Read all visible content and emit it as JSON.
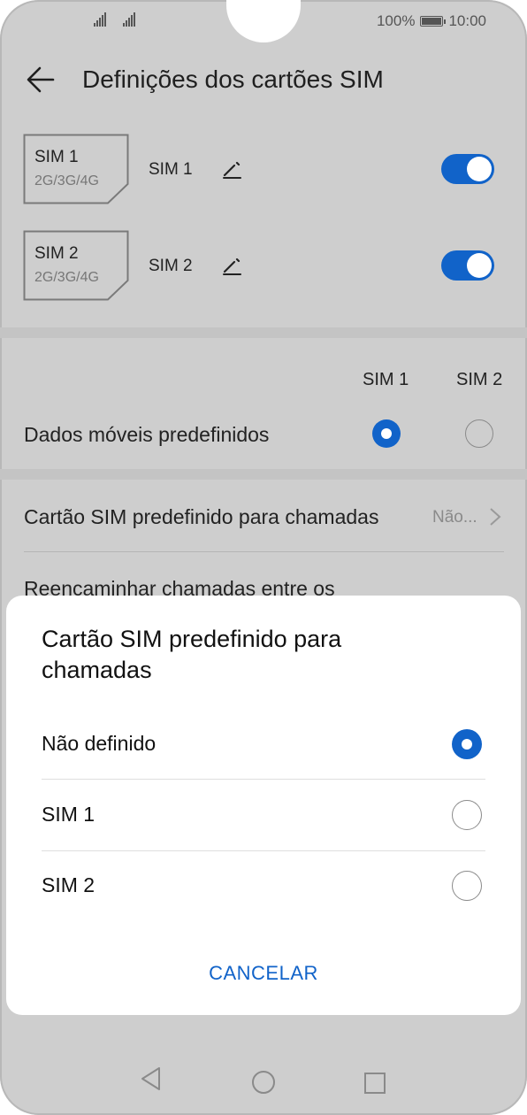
{
  "status_bar": {
    "battery": "100%",
    "time": "10:00",
    "icons": [
      "signal-1-icon",
      "signal-2-icon",
      "battery-icon"
    ]
  },
  "header": {
    "title": "Definições dos cartões SIM",
    "back_icon": "back-arrow-icon"
  },
  "sim_cards": [
    {
      "card_label": "SIM 1",
      "card_tech": "2G/3G/4G",
      "name": "SIM 1",
      "enabled": true
    },
    {
      "card_label": "SIM 2",
      "card_tech": "2G/3G/4G",
      "name": "SIM 2",
      "enabled": true
    }
  ],
  "columns": {
    "sim1": "SIM 1",
    "sim2": "SIM 2"
  },
  "mobile_data": {
    "label": "Dados móveis predefinidos",
    "selected": "SIM 1"
  },
  "default_calls": {
    "label": "Cartão SIM predefinido para chamadas",
    "value": "Não..."
  },
  "forwarding": {
    "label": "Reencaminhar chamadas entre os"
  },
  "dialog": {
    "title": "Cartão SIM predefinido para chamadas",
    "options": [
      {
        "label": "Não definido",
        "selected": true
      },
      {
        "label": "SIM 1",
        "selected": false
      },
      {
        "label": "SIM 2",
        "selected": false
      }
    ],
    "cancel_label": "CANCELAR"
  },
  "colors": {
    "accent": "#1163c9",
    "overlay": "#cecece",
    "dialog_bg": "#ffffff"
  },
  "nav_icons": [
    "nav-back-icon",
    "nav-home-icon",
    "nav-recents-icon"
  ]
}
